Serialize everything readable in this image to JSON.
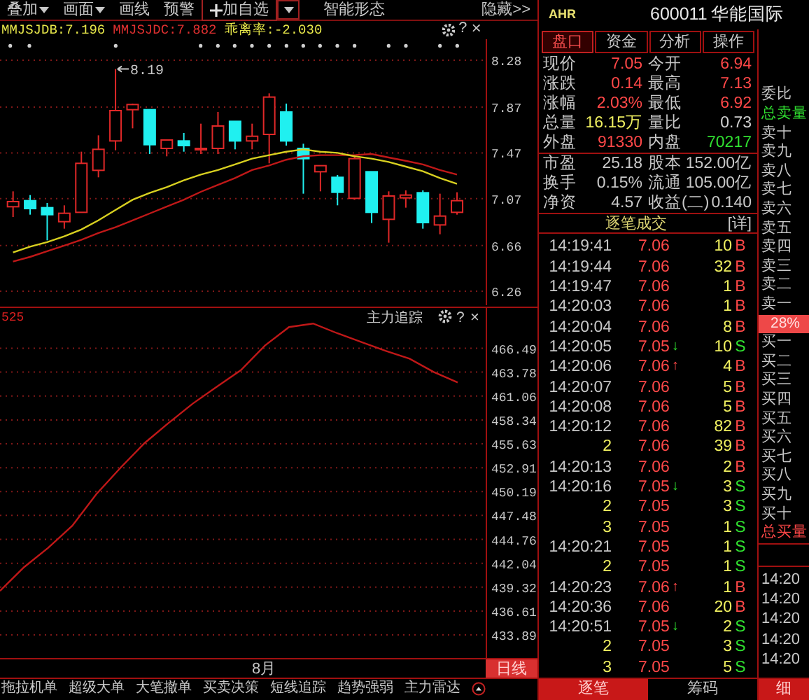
{
  "toolbar": [
    {
      "label": "叠加",
      "dropdown": true,
      "boxed": false
    },
    {
      "label": "画面",
      "dropdown": true,
      "boxed": false
    },
    {
      "label": "画线",
      "dropdown": false,
      "boxed": false
    },
    {
      "label": "预警",
      "dropdown": false,
      "boxed": false
    },
    {
      "label": "加自选",
      "dropdown": true,
      "boxed": true
    },
    {
      "label": "智能形态",
      "dropdown": false,
      "boxed": false
    }
  ],
  "hide_link": "隐藏>>",
  "price_chart": {
    "indicators": [
      {
        "text": "MMJSJDB:7.196",
        "color": "#e8e84a"
      },
      {
        "text": "MMJSJDC:7.882",
        "color": "#e03030"
      },
      {
        "text": "乖离率:-2.030",
        "color": "#e8e84a"
      }
    ],
    "help": "?",
    "close": "×",
    "high_label": "8.19",
    "chart_data": {
      "type": "line",
      "grid": true,
      "categories": [
        null,
        null,
        null,
        null,
        null,
        null,
        null,
        null,
        null,
        null,
        null,
        null,
        null,
        null,
        null,
        null,
        null,
        null,
        null,
        null,
        null,
        null,
        null,
        null,
        null,
        null,
        null
      ],
      "ylim": [
        6.138,
        8.464
      ],
      "yticks": [
        {
          "value": 8.28,
          "label": "8.28"
        },
        {
          "value": 7.87,
          "label": "7.87"
        },
        {
          "value": 7.47,
          "label": "7.47"
        },
        {
          "value": 7.07,
          "label": "7.07"
        },
        {
          "value": 6.66,
          "label": "6.66"
        },
        {
          "value": 6.26,
          "label": "6.26"
        }
      ],
      "series": [
        {
          "color": "#c01818",
          "values": [
            6.52,
            6.56,
            6.61,
            6.66,
            6.71,
            6.77,
            6.82,
            6.88,
            6.94,
            7.0,
            7.06,
            7.13,
            7.19,
            7.25,
            7.32,
            7.36,
            7.41,
            7.44,
            7.45,
            7.45,
            7.45,
            7.46,
            7.43,
            7.4,
            7.37,
            7.32,
            7.28
          ]
        },
        {
          "color": "#d8d020",
          "values": [
            6.6,
            6.65,
            6.69,
            6.74,
            6.8,
            6.88,
            6.97,
            7.06,
            7.12,
            7.17,
            7.23,
            7.28,
            7.32,
            7.37,
            7.42,
            7.45,
            7.48,
            7.5,
            7.48,
            7.47,
            7.44,
            7.42,
            7.39,
            7.35,
            7.31,
            7.25,
            7.2
          ]
        }
      ]
    }
  },
  "indicator_chart": {
    "value": "525",
    "help": "?",
    "close": "×",
    "chart_data": {
      "type": "line",
      "grid": true,
      "categories": [
        null,
        null,
        null,
        null,
        null,
        null,
        null,
        null,
        null,
        null,
        null,
        null,
        null,
        null,
        null,
        null,
        null,
        null,
        null,
        null
      ],
      "ylim": [
        431.27,
        471.07
      ],
      "yticks": [
        {
          "value": 466.49,
          "label": "466.49"
        },
        {
          "value": 463.78,
          "label": "463.78"
        },
        {
          "value": 461.06,
          "label": "461.06"
        },
        {
          "value": 458.34,
          "label": "458.34"
        },
        {
          "value": 455.63,
          "label": "455.63"
        },
        {
          "value": 452.91,
          "label": "452.91"
        },
        {
          "value": 450.19,
          "label": "450.19"
        },
        {
          "value": 447.48,
          "label": "447.48"
        },
        {
          "value": 444.76,
          "label": "444.76"
        },
        {
          "value": 442.04,
          "label": "442.04"
        },
        {
          "value": 439.32,
          "label": "439.32"
        },
        {
          "value": 436.61,
          "label": "436.61"
        },
        {
          "value": 433.89,
          "label": "433.89"
        }
      ],
      "series": [
        {
          "name": "主力追踪",
          "color": "#c01818",
          "values": [
            438.9,
            441.6,
            443.8,
            446.3,
            449.9,
            452.9,
            455.7,
            458.0,
            460.2,
            462.1,
            464.0,
            466.8,
            468.9,
            469.3,
            468.2,
            467.2,
            466.2,
            465.3,
            463.8,
            462.6
          ]
        }
      ]
    }
  },
  "x_axis_label": "8月",
  "period_button": {
    "label": "日线",
    "selected": true
  },
  "bottom_tabs": [
    {
      "label": "拖拉机单",
      "selected": false
    },
    {
      "label": "超级大单",
      "selected": false
    },
    {
      "label": "大笔撤单",
      "selected": false
    },
    {
      "label": "买卖决策",
      "selected": false
    },
    {
      "label": "短线追踪",
      "selected": false
    },
    {
      "label": "趋势强弱",
      "selected": false
    },
    {
      "label": "主力雷达",
      "selected": false
    }
  ],
  "stock": {
    "badge": "AHR",
    "code": "600011",
    "name": "华能国际"
  },
  "panel_tabs": [
    {
      "label": "盘口",
      "selected": true
    },
    {
      "label": "资金",
      "selected": false
    },
    {
      "label": "分析",
      "selected": false
    },
    {
      "label": "操作",
      "selected": false
    }
  ],
  "quote_rows": [
    {
      "cells": [
        {
          "label": "现价",
          "value": "7.05",
          "color": "#ff4848"
        },
        {
          "label": "今开",
          "value": "6.94",
          "color": "#ff4848"
        }
      ]
    },
    {
      "cells": [
        {
          "label": "涨跌",
          "value": "0.14",
          "color": "#ff4848"
        },
        {
          "label": "最高",
          "value": "7.13",
          "color": "#ff4848"
        }
      ]
    },
    {
      "cells": [
        {
          "label": "涨幅",
          "value": "2.03%",
          "color": "#ff4848"
        },
        {
          "label": "最低",
          "value": "6.92",
          "color": "#ff4848"
        }
      ]
    },
    {
      "cells": [
        {
          "label": "总量",
          "value": "16.15万",
          "color": "#f0f060"
        },
        {
          "label": "量比",
          "value": "0.73",
          "color": "#d0d0d0"
        }
      ]
    },
    {
      "cells": [
        {
          "label": "外盘",
          "value": "91330",
          "color": "#ff4848"
        },
        {
          "label": "内盘",
          "value": "70217",
          "color": "#30e030"
        }
      ]
    }
  ],
  "fundamental_rows": [
    {
      "cells": [
        {
          "label": "市盈",
          "value": "25.18"
        },
        {
          "label": "股本",
          "value": "152.00亿"
        }
      ]
    },
    {
      "cells": [
        {
          "label": "换手",
          "value": "0.15%"
        },
        {
          "label": "流通",
          "value": "105.00亿"
        }
      ]
    },
    {
      "cells": [
        {
          "label": "净资",
          "value": "4.57"
        },
        {
          "label": "收益(二)",
          "value": "0.140"
        }
      ]
    }
  ],
  "trades": {
    "title": "逐笔成交",
    "detail": "[详]",
    "rows": [
      {
        "kind": "time",
        "time": "14:19:41",
        "price": "7.06",
        "volume": "10",
        "side": "B",
        "selling": false
      },
      {
        "kind": "time",
        "time": "14:19:44",
        "price": "7.06",
        "volume": "32",
        "side": "B",
        "selling": false
      },
      {
        "kind": "time",
        "time": "14:19:47",
        "price": "7.06",
        "volume": "1",
        "side": "B",
        "selling": false
      },
      {
        "kind": "time",
        "time": "14:20:03",
        "price": "7.06",
        "volume": "1",
        "side": "B",
        "selling": false
      },
      {
        "kind": "time",
        "time": "14:20:04",
        "price": "7.06",
        "volume": "8",
        "side": "B",
        "selling": false
      },
      {
        "kind": "time",
        "time": "14:20:05",
        "price": "7.05",
        "arrow": "↓",
        "volume": "10",
        "side": "S",
        "selling": true
      },
      {
        "kind": "time",
        "time": "14:20:06",
        "price": "7.06",
        "arrow": "↑",
        "volume": "4",
        "side": "B",
        "selling": false
      },
      {
        "kind": "time",
        "time": "14:20:07",
        "price": "7.06",
        "volume": "5",
        "side": "B",
        "selling": false
      },
      {
        "kind": "time",
        "time": "14:20:08",
        "price": "7.06",
        "volume": "5",
        "side": "B",
        "selling": false
      },
      {
        "kind": "time",
        "time": "14:20:12",
        "price": "7.06",
        "volume": "82",
        "side": "B",
        "selling": false
      },
      {
        "kind": "seq",
        "time": "2",
        "price": "7.06",
        "volume": "39",
        "side": "B",
        "selling": false
      },
      {
        "kind": "time",
        "time": "14:20:13",
        "price": "7.06",
        "volume": "2",
        "side": "B",
        "selling": false
      },
      {
        "kind": "time",
        "time": "14:20:16",
        "price": "7.05",
        "arrow": "↓",
        "volume": "3",
        "side": "S",
        "selling": true
      },
      {
        "kind": "seq",
        "time": "2",
        "price": "7.05",
        "volume": "3",
        "side": "S",
        "selling": true
      },
      {
        "kind": "seq",
        "time": "3",
        "price": "7.05",
        "volume": "1",
        "side": "S",
        "selling": true
      },
      {
        "kind": "time",
        "time": "14:20:21",
        "price": "7.05",
        "volume": "1",
        "side": "S",
        "selling": true
      },
      {
        "kind": "seq",
        "time": "2",
        "price": "7.05",
        "volume": "1",
        "side": "S",
        "selling": true
      },
      {
        "kind": "time",
        "time": "14:20:23",
        "price": "7.06",
        "arrow": "↑",
        "volume": "1",
        "side": "B",
        "selling": false
      },
      {
        "kind": "time",
        "time": "14:20:36",
        "price": "7.06",
        "volume": "20",
        "side": "B",
        "selling": false
      },
      {
        "kind": "time",
        "time": "14:20:51",
        "price": "7.05",
        "arrow": "↓",
        "volume": "2",
        "side": "S",
        "selling": true
      },
      {
        "kind": "seq",
        "time": "2",
        "price": "7.05",
        "volume": "3",
        "side": "S",
        "selling": true
      },
      {
        "kind": "seq",
        "time": "3",
        "price": "7.05",
        "volume": "5",
        "side": "S",
        "selling": true
      }
    ]
  },
  "trade_tabs": [
    {
      "label": "逐笔",
      "selected": true
    },
    {
      "label": "筹码",
      "selected": false
    }
  ],
  "depth": {
    "title": "委比",
    "sell_total": "总卖量",
    "sell_levels": [
      "卖十",
      "卖九",
      "卖八",
      "卖七",
      "卖六",
      "卖五",
      "卖四",
      "卖三",
      "卖二",
      "卖一"
    ],
    "ratio": "28%",
    "buy_levels": [
      "买一",
      "买二",
      "买三",
      "买四",
      "买五",
      "买六",
      "买七",
      "买八",
      "买九",
      "买十"
    ],
    "buy_total": "总买量",
    "times": [
      "14:20",
      "14:20",
      "14:20",
      "14:20",
      "14:20"
    ]
  },
  "detail_tab": {
    "label": "细",
    "selected": true
  }
}
